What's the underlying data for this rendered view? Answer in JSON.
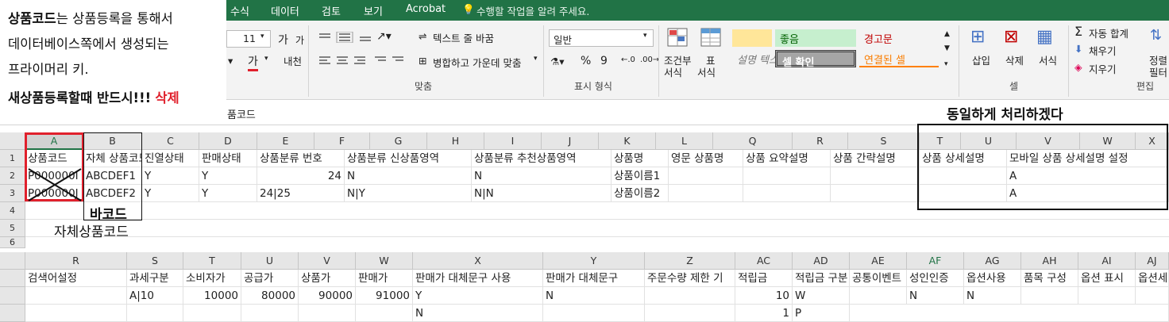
{
  "menu": {
    "tabs": [
      "수식",
      "데이터",
      "검토",
      "보기",
      "Acrobat"
    ],
    "tell_me": "수행할 작업을 알려 주세요."
  },
  "ribbon": {
    "font_size": "11",
    "grow_font": "가",
    "shrink_font": "가",
    "underline_label": "가",
    "ext_label": "내천",
    "wrap_text": "텍스트 줄 바꿈",
    "merge_center": "병합하고 가운데 맞춤",
    "number_format": "일반",
    "percent": "%",
    "comma": "9",
    "align_group": "맞춤",
    "number_group": "표시 형식",
    "cond_format": [
      "조건부",
      "서식"
    ],
    "table_format": [
      "표",
      "서식"
    ],
    "styles": {
      "normal": "",
      "good": "좋음",
      "bad": "경고문",
      "explanatory": "설명 텍스트",
      "check_cell": "셀 확인",
      "linked_cell": "연결된 셀"
    },
    "cells_group": "셀",
    "insert": "삽입",
    "delete": "삭제",
    "format": "서식",
    "autosum": "자동 합계",
    "fill": "채우기",
    "clear": "지우기",
    "sort": [
      "정렬",
      "필터"
    ],
    "editing_group": "편집"
  },
  "formula_bar": {
    "content": "품코드"
  },
  "note": {
    "line1_bold": "상품코드",
    "line1_rest": "는 상품등록을 통해서",
    "line2": "데이터베이스쪽에서 생성되는",
    "line3": "프라이머리 키.",
    "line4_bold": "새상품등록할때 반드시!!!",
    "line4_red": "삭제"
  },
  "annotations": {
    "top_right": "동일하게 처리하겠다",
    "barcode": "바코드",
    "own_code": "자체상품코드"
  },
  "grid1": {
    "columns": [
      "A",
      "B",
      "C",
      "D",
      "E",
      "F",
      "G",
      "H",
      "I",
      "J",
      "K",
      "L",
      "Q",
      "R",
      "S",
      "T",
      "U",
      "V",
      "W",
      "X"
    ],
    "rows": [
      "1",
      "2",
      "3",
      "4",
      "5",
      "6"
    ],
    "headers": [
      "상품코드",
      "자체 상품코드",
      "진열상태",
      "판매상태",
      "상품분류 번호",
      "상품분류 신상품영역",
      "상품분류 추천상품영역",
      "상품명",
      "영문 상품명",
      "상품 요약설명",
      "상품 간략설명",
      "상품 상세설명",
      "모바일 상품 상세설명 설정"
    ],
    "row2": {
      "a": "P000000I",
      "b": "ABCDEF1",
      "c": "Y",
      "d": "Y",
      "f": "24",
      "g": "N",
      "i": "N",
      "k": "상품이름1",
      "v": "A"
    },
    "row3": {
      "a": "P000000J",
      "b": "ABCDEF2",
      "c": "Y",
      "d": "Y",
      "e": "24|25",
      "g": "N|Y",
      "i": "N|N",
      "k": "상품이름2",
      "v": "A"
    }
  },
  "grid2": {
    "columns": [
      "R",
      "S",
      "T",
      "U",
      "V",
      "W",
      "X",
      "Y",
      "Z",
      "AC",
      "AD",
      "AE",
      "AF",
      "AG",
      "AH",
      "AI",
      "AJ"
    ],
    "headers": [
      "검색어설정",
      "과세구분",
      "소비자가",
      "공급가",
      "상품가",
      "판매가",
      "판매가 대체문구 사용",
      "판매가 대체문구",
      "주문수량 제한 기",
      "적립금",
      "적립금 구분",
      "공통이벤트",
      "성인인증",
      "옵션사용",
      "품목 구성",
      "옵션 표시",
      "옵션세"
    ],
    "row2": {
      "s": "A|10",
      "t": "10000",
      "u": "80000",
      "v": "90000",
      "w": "91000",
      "x": "Y",
      "y": "N",
      "ac": "10",
      "ad": "W",
      "af": "N",
      "ag": "N"
    },
    "row3": {
      "x": "N",
      "ac": "1",
      "ad": "P"
    }
  },
  "colors": {
    "excel_green": "#217346",
    "accent_red": "#e0202c",
    "good_fill": "#c6efce",
    "bad_text": "#9c0006"
  }
}
